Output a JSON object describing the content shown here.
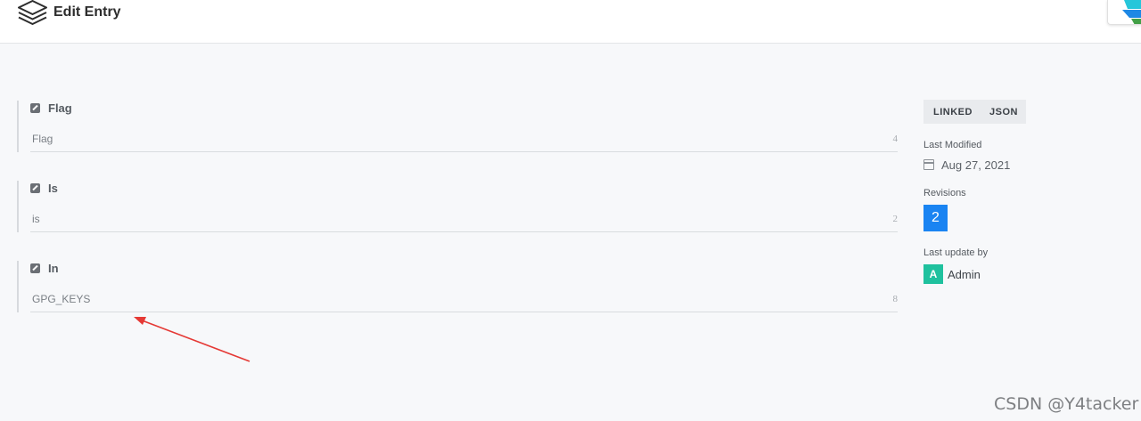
{
  "header": {
    "title": "Edit Entry",
    "logo_icon": "layers-icon",
    "corner_icon": "app-icon"
  },
  "fields": [
    {
      "label": "Flag",
      "value": "Flag",
      "count": "4",
      "icon": "edit-icon"
    },
    {
      "label": "Is",
      "value": "is",
      "count": "2",
      "icon": "edit-icon"
    },
    {
      "label": "In",
      "value": "GPG_KEYS",
      "count": "8",
      "icon": "edit-icon"
    }
  ],
  "sidebar": {
    "tabs": [
      "LINKED",
      "JSON"
    ],
    "last_modified_label": "Last Modified",
    "last_modified_date": "Aug 27, 2021",
    "calendar_icon": "calendar-icon",
    "revisions_label": "Revisions",
    "revisions_count": "2",
    "last_update_label": "Last update by",
    "avatar_initial": "A",
    "user_name": "Admin"
  },
  "colors": {
    "accent": "#1a84f2",
    "avatar": "#1fc19e",
    "annotation": "#e53935"
  },
  "watermark": "CSDN @Y4tacker"
}
